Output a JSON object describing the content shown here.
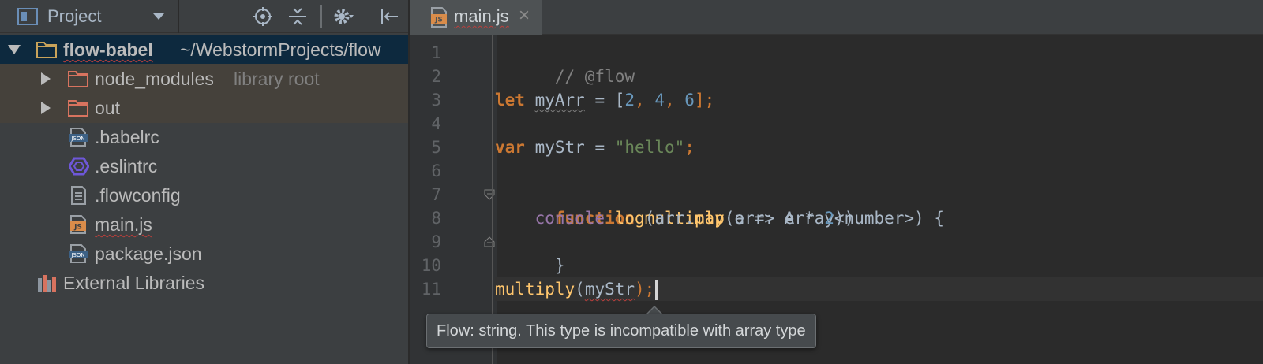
{
  "project_panel": {
    "title": "Project",
    "tree": [
      {
        "label": "flow-babel",
        "sub": "~/WebstormProjects/flow"
      },
      {
        "label": "node_modules",
        "sub": "library root"
      },
      {
        "label": "out"
      },
      {
        "label": ".babelrc"
      },
      {
        "label": ".eslintrc"
      },
      {
        "label": ".flowconfig"
      },
      {
        "label": "main.js"
      },
      {
        "label": "package.json"
      },
      {
        "label": "External Libraries"
      }
    ]
  },
  "editor": {
    "tab": {
      "label": "main.js",
      "close_glyph": "×"
    },
    "line_numbers": [
      "1",
      "2",
      "3",
      "4",
      "5",
      "6",
      "7",
      "8",
      "9",
      "10",
      "11"
    ],
    "code": {
      "l1": "// @flow",
      "l3": {
        "kw": "let",
        "name": "myArr",
        "op": " = [",
        "n1": "2",
        "c1": ", ",
        "n2": "4",
        "c2": ", ",
        "n3": "6",
        "end": "];"
      },
      "l5": {
        "kw": "var",
        "name": " myStr = ",
        "str": "\"hello\"",
        "end": ";"
      },
      "l7": {
        "kw": "function",
        "fn": "multiply",
        "rest": "(arr: Array<number>) {"
      },
      "l8": {
        "indent": "    ",
        "obj": "console",
        "dot": ".",
        "m1": "log",
        "p1": "(arr.",
        "m2": "map",
        "p2": "(e => e * ",
        "n": "2",
        "end": "))"
      },
      "l9": "}",
      "l11": {
        "fn": "multiply",
        "open": "(",
        "arg": "myStr",
        "end": ");"
      }
    },
    "tooltip": "Flow: string. This type is incompatible with array type"
  },
  "colors": {
    "keyword": "#cc7832",
    "number": "#6897bb",
    "string": "#6a8759",
    "function": "#ffc66d",
    "comment": "#808080",
    "error_underline": "#bc3f3c"
  }
}
